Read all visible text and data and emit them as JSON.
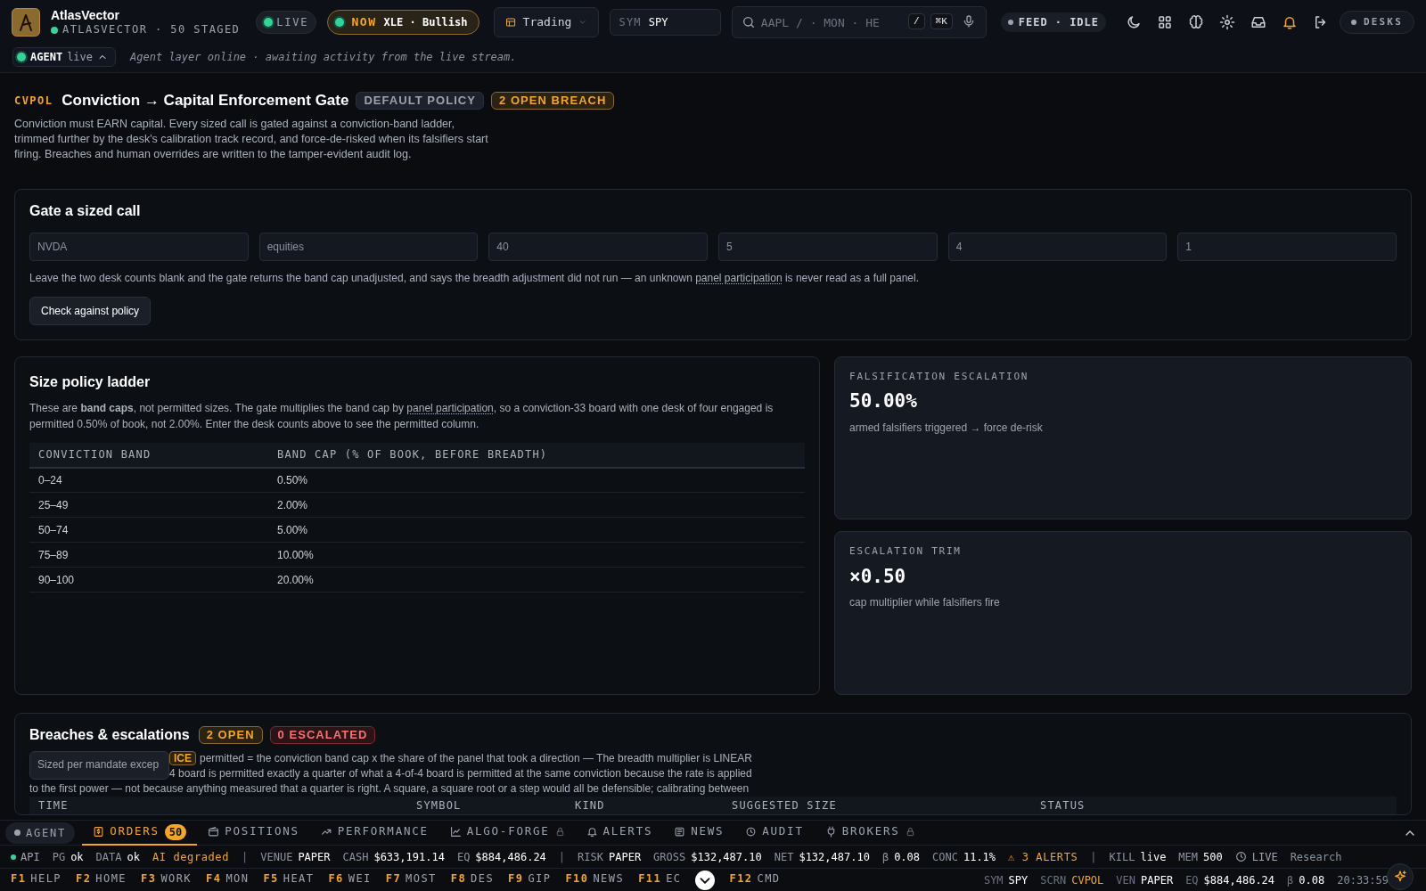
{
  "brand": {
    "name": "AtlasVector",
    "subtitle": "ATLASVECTOR · 50 STAGED"
  },
  "live_pill": {
    "label": "LIVE"
  },
  "now_pill": {
    "label": "NOW",
    "value": "XLE · Bullish"
  },
  "workspace_dropdown": {
    "label": "Trading"
  },
  "symbol_field": {
    "label": "SYM",
    "value": "SPY"
  },
  "search": {
    "placeholder": "AAPL / · MON · HE",
    "keys": [
      "/",
      "⌘K"
    ]
  },
  "feed_pill": {
    "label": "FEED · IDLE"
  },
  "desks_pill": {
    "label": "DESKS"
  },
  "agent_bar": {
    "label": "AGENT",
    "state": "live",
    "expanded": true,
    "message": "Agent layer online · awaiting activity from the live stream."
  },
  "page_header": {
    "code": "CVPOL",
    "title": "Conviction → Capital Enforcement Gate",
    "badges": [
      {
        "label": "DEFAULT POLICY",
        "kind": "neutral"
      },
      {
        "label": "2 OPEN BREACH",
        "kind": "warn"
      }
    ],
    "description": "Conviction must EARN capital. Every sized call is gated against a conviction-band ladder, trimmed further by the desk's calibration track record, and force-de-risked when its falsifiers start firing. Breaches and human overrides are written to the tamper-evident audit log."
  },
  "gate": {
    "title": "Gate a sized call",
    "fields": [
      {
        "placeholder": "NVDA"
      },
      {
        "placeholder": "equities"
      },
      {
        "placeholder": "40"
      },
      {
        "placeholder": "5"
      },
      {
        "placeholder": "4"
      },
      {
        "placeholder": "1"
      }
    ],
    "hint": [
      {
        "kind": "text",
        "text": "Leave the two desk counts blank and the gate returns the band cap unadjusted, and says the breadth adjustment did not run — an unknown "
      },
      {
        "kind": "link",
        "text": "panel participation"
      },
      {
        "kind": "text",
        "text": " is never read as a full panel."
      }
    ],
    "button": "Check against policy"
  },
  "ladder": {
    "title": "Size policy ladder",
    "note": [
      {
        "kind": "text",
        "text": "These are **band caps**, not permitted sizes. The gate multiplies the band cap by "
      },
      {
        "kind": "link",
        "text": "panel participation"
      },
      {
        "kind": "text",
        "text": ", so a conviction-33 board with one desk of four engaged is permitted 0.50% of book, not 2.00%. Enter the desk counts above to see the permitted column."
      }
    ],
    "columns": [
      "CONVICTION BAND",
      "BAND CAP (% OF BOOK, BEFORE BREADTH)"
    ],
    "rows": [
      [
        "0–24",
        "0.50%"
      ],
      [
        "25–49",
        "2.00%"
      ],
      [
        "50–74",
        "5.00%"
      ],
      [
        "75–89",
        "10.00%"
      ],
      [
        "90–100",
        "20.00%"
      ]
    ]
  },
  "metrics": [
    {
      "label": "FALSIFICATION ESCALATION",
      "value": "50.00%",
      "caption": "armed falsifiers triggered → force de-risk"
    },
    {
      "label": "ESCALATION TRIM",
      "value": "×0.50",
      "caption": "cap multiplier while falsifiers fire"
    }
  ],
  "breaches": {
    "title": "Breaches & escalations",
    "badges": [
      {
        "label": "2 OPEN",
        "kind": "warn"
      },
      {
        "label": "0 ESCALATED",
        "kind": "danger"
      }
    ],
    "tooltip": "Sized per mandate excep",
    "badge": "ICE",
    "text_lines": [
      "permitted = the conviction band cap x the share of the panel that took a direction — The breadth multiplier is LINEAR",
      "4 board is permitted exactly a quarter of what a 4-of-4 board is permitted at the same conviction because the rate is applied",
      "to the first power — not because anything measured that a quarter is right. A square, a square root or a step would all be defensible; calibrating between"
    ],
    "columns": [
      "TIME",
      "SYMBOL",
      "KIND",
      "SUGGESTED SIZE",
      "STATUS"
    ]
  },
  "bottom_tabs": {
    "agent": "AGENT",
    "tabs": [
      {
        "label": "ORDERS",
        "count": "50",
        "selected": true,
        "locked": false
      },
      {
        "label": "POSITIONS",
        "selected": false,
        "locked": false
      },
      {
        "label": "PERFORMANCE",
        "selected": false,
        "locked": false
      },
      {
        "label": "ALGO-FORGE",
        "selected": false,
        "locked": true
      },
      {
        "label": "ALERTS",
        "selected": false,
        "locked": false
      },
      {
        "label": "NEWS",
        "selected": false,
        "locked": false
      },
      {
        "label": "AUDIT",
        "selected": false,
        "locked": false
      },
      {
        "label": "BROKERS",
        "selected": false,
        "locked": true
      }
    ]
  },
  "status_bar": [
    {
      "kind": "dot",
      "label": "API"
    },
    {
      "kind": "pair",
      "label": "PG",
      "value": "ok"
    },
    {
      "kind": "pair",
      "label": "DATA",
      "value": "ok"
    },
    {
      "kind": "warn",
      "label": "AI degraded"
    },
    {
      "kind": "sep",
      "label": "|"
    },
    {
      "kind": "pair",
      "label": "VENUE",
      "value": "PAPER"
    },
    {
      "kind": "pair",
      "label": "CASH",
      "value": "$633,191.14"
    },
    {
      "kind": "pair",
      "label": "EQ",
      "value": "$884,486.24"
    },
    {
      "kind": "sep",
      "label": "|"
    },
    {
      "kind": "pair",
      "label": "RISK",
      "value": "PAPER"
    },
    {
      "kind": "pair",
      "label": "GROSS",
      "value": "$132,487.10"
    },
    {
      "kind": "pair",
      "label": "NET",
      "value": "$132,487.10"
    },
    {
      "kind": "pair",
      "label": "β",
      "value": "0.08"
    },
    {
      "kind": "pair",
      "label": "CONC",
      "value": "11.1%"
    },
    {
      "kind": "warn",
      "label": "⚠ 3 ALERTS"
    },
    {
      "kind": "sep",
      "label": "|"
    },
    {
      "kind": "pair",
      "label": "KILL",
      "value": "live"
    },
    {
      "kind": "pair",
      "label": "MEM",
      "value": "500"
    },
    {
      "kind": "clock",
      "label": "LIVE"
    },
    {
      "kind": "plain",
      "label": "Research"
    }
  ],
  "fkeys": [
    {
      "key": "F1",
      "label": "HELP"
    },
    {
      "key": "F2",
      "label": "HOME"
    },
    {
      "key": "F3",
      "label": "WORK"
    },
    {
      "key": "F4",
      "label": "MON"
    },
    {
      "key": "F5",
      "label": "HEAT"
    },
    {
      "key": "F6",
      "label": "WEI"
    },
    {
      "key": "F7",
      "label": "MOST"
    },
    {
      "key": "F8",
      "label": "DES"
    },
    {
      "key": "F9",
      "label": "GIP"
    },
    {
      "key": "F10",
      "label": "NEWS"
    },
    {
      "key": "F11",
      "label": "EC"
    },
    {
      "key": "F12",
      "label": "CMD"
    }
  ],
  "fkey_status": [
    {
      "label": "SYM",
      "value": "SPY",
      "accent": false
    },
    {
      "label": "SCRN",
      "value": "CVPOL",
      "accent": true
    },
    {
      "label": "VEN",
      "value": "PAPER",
      "accent": false
    },
    {
      "label": "EQ",
      "value": "$884,486.24",
      "accent": false
    },
    {
      "label": "β",
      "value": "0.08",
      "accent": false
    }
  ],
  "clock": "20:33:59"
}
